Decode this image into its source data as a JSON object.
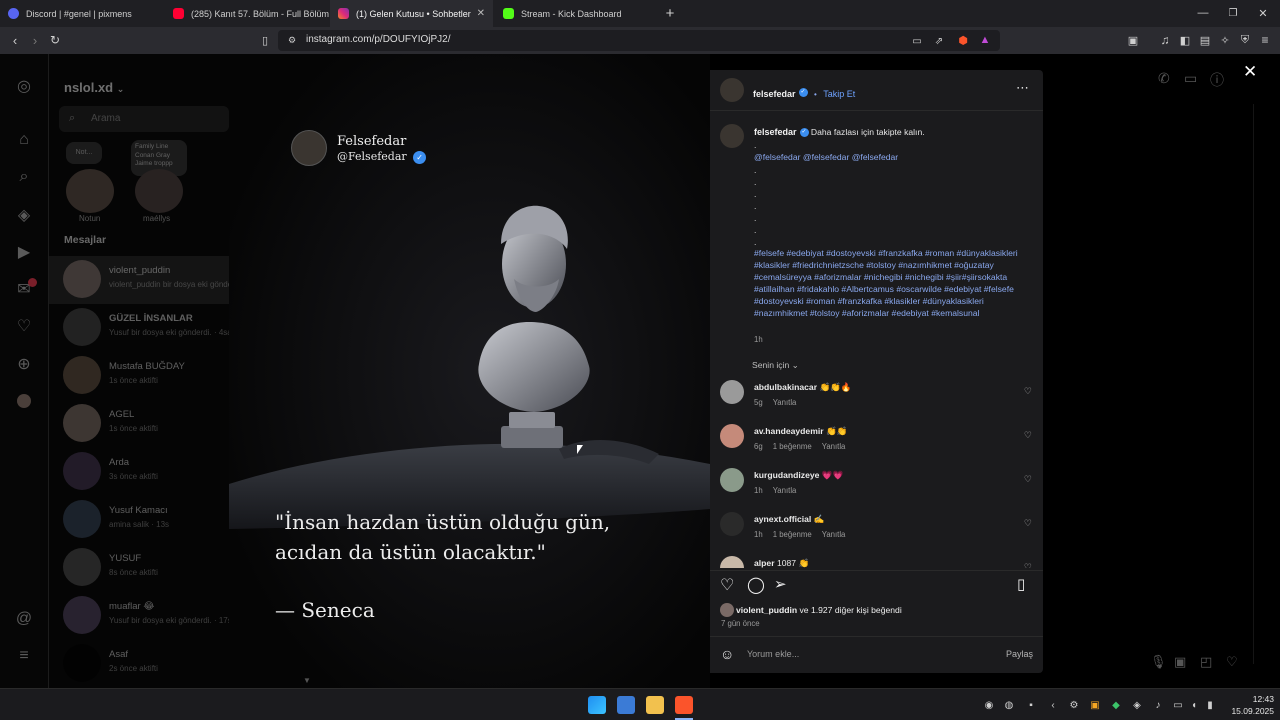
{
  "tabs": [
    {
      "title": "Discord | #genel | pixmens",
      "color": "#5865f2"
    },
    {
      "title": "(285) Kanıt 57. Bölüm - Full Bölüm - Y",
      "color": "#ff0033"
    },
    {
      "title": "(1) Gelen Kutusu • Sohbetler",
      "color": "#d62976"
    },
    {
      "title": "Stream - Kick Dashboard",
      "color": "#53fc18"
    }
  ],
  "address": {
    "url": "instagram.com/p/DOUFYIOjPJ2/"
  },
  "dm": {
    "account": "nslol.xd",
    "search_placeholder": "Arama",
    "notes": [
      {
        "bubble": "Not...",
        "label": "Notun"
      },
      {
        "bubble_lines": [
          "Family Line",
          "Conan Gray",
          "Jaime troppp"
        ],
        "label": "maéllys"
      }
    ],
    "section_title": "Mesajlar",
    "conversations": [
      {
        "name": "violent_puddin",
        "sub": "violent_puddin bir dosya eki gönderdi.",
        "color": "#7a6a66"
      },
      {
        "name": "GÜZEL İNSANLAR",
        "sub": "Yusuf bir dosya eki gönderdi. · 4sa",
        "color": "#4a4a4a",
        "bold": true
      },
      {
        "name": "Mustafa BUĞDAY",
        "sub": "1s önce aktifti",
        "color": "#6b5a48"
      },
      {
        "name": "AGEL",
        "sub": "1s önce aktifti",
        "color": "#8a7a70"
      },
      {
        "name": "Arda",
        "sub": "3s önce aktifti",
        "color": "#4a3a5a"
      },
      {
        "name": "Yusuf Kamacı",
        "sub": "amina salik · 13s",
        "color": "#3a4a60"
      },
      {
        "name": "YUSUF",
        "sub": "8s önce aktifti",
        "color": "#555555"
      },
      {
        "name": "muaflar 😂",
        "sub": "Yusuf bir dosya eki gönderdi. · 17s",
        "color": "#5a4a6a"
      },
      {
        "name": "Asaf",
        "sub": "2s önce aktifti",
        "color": "#000000"
      }
    ]
  },
  "media": {
    "author_name": "Felsefedar",
    "author_handle": "@Felsefedar",
    "quote_line1": "\"İnsan hazdan üstün olduğu gün,",
    "quote_line2": "acıdan da üstün olacaktır.\"",
    "attribution": "—  Seneca"
  },
  "post": {
    "username": "felsefedar",
    "follow_label": "Takip Et",
    "caption_text": "Daha fazlası için takipte kalın.",
    "mentions": "@felsefedar @felsefedar @felsefedar",
    "dots": [
      ".",
      ".",
      ".",
      ".",
      ".",
      ".",
      ".",
      "."
    ],
    "hashtags": "#felsefe #edebiyat #dostoyevski #franzkafka #roman #dünyaklasikleri #klasikler #friedrichnietzsche #tolstoy #nazımhikmet #oğuzatay #cemalsüreyya #aforizmalar #nichegibi #nichegibi #şiir#şiirsokakta #atillailhan #fridakahlo #Albertcamus #oscarwilde #edebiyat #felsefe #dostoyevski #roman #franzkafka #klasikler #dünyaklasikleri #nazımhikmet #tolstoy #aforizmalar #edebiyat #kemalsunal",
    "caption_time": "1h",
    "sort_label": "Senin için",
    "comments": [
      {
        "user": "abdulbakinacar",
        "text": "👏👏🔥",
        "time": "5g",
        "likes": "",
        "reply": "Yanıtla",
        "color": "#9a9a9a"
      },
      {
        "user": "av.handeaydemir",
        "text": "👏👏",
        "time": "6g",
        "likes": "1 beğenme",
        "reply": "Yanıtla",
        "color": "#c58a7a"
      },
      {
        "user": "kurgudandizeye",
        "text": "💗💗",
        "time": "1h",
        "likes": "",
        "reply": "Yanıtla",
        "color": "#8a9a8a"
      },
      {
        "user": "aynext.official",
        "text": "✍️",
        "time": "1h",
        "likes": "1 beğenme",
        "reply": "Yanıtla",
        "color": "#2a2a2a"
      },
      {
        "user": "alper",
        "text": "1087 👏",
        "time": "",
        "likes": "",
        "reply": "",
        "color": "#c8b8a8"
      }
    ],
    "likes_user": "violent_puddin",
    "likes_rest": " ve 1.927 diğer kişi beğendi",
    "posted_ago": "7 gün önce",
    "comment_placeholder": "Yorum ekle...",
    "share_label": "Paylaş"
  },
  "taskbar": {
    "time": "12:43",
    "date": "15.09.2025"
  }
}
